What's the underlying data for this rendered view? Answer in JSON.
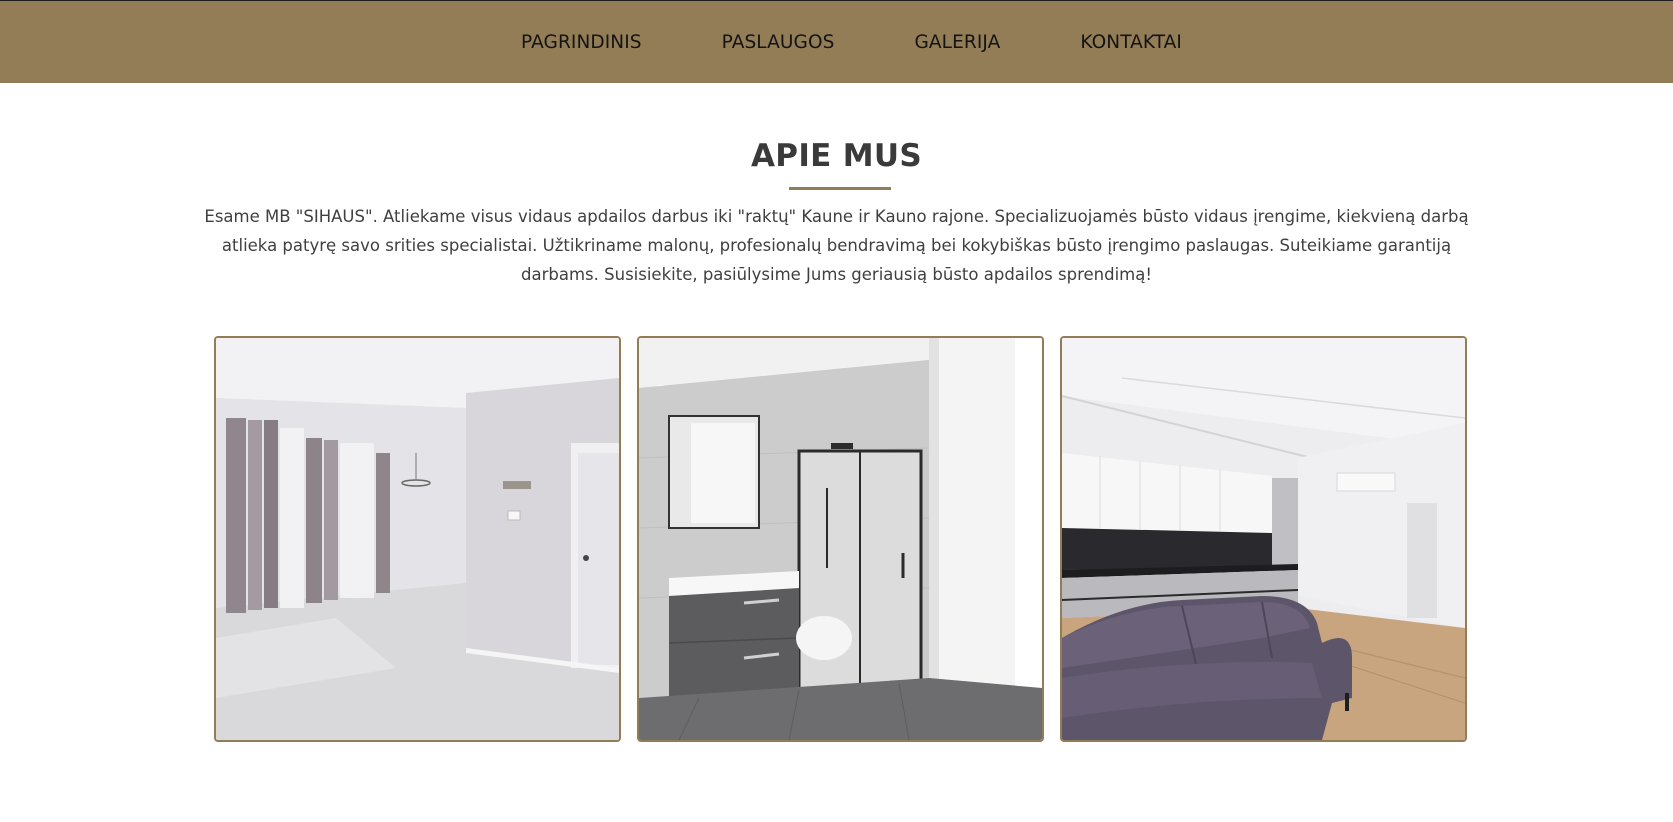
{
  "nav": {
    "items": [
      {
        "label": "PAGRINDINIS"
      },
      {
        "label": "PASLAUGOS"
      },
      {
        "label": "GALERIJA"
      },
      {
        "label": "KONTAKTAI"
      }
    ]
  },
  "about": {
    "title": "APIE MUS",
    "text": "Esame MB \"SIHAUS\". Atliekame visus vidaus apdailos darbus iki \"raktų\" Kaune ir Kauno rajone. Specializuojamės būsto vidaus įrengime, kiekvieną darbą atlieka patyrę savo srities specialistai. Užtikriname malonų, profesionalų bendravimą bei kokybiškas būsto įrengimo paslaugas. Suteikiame garantiją darbams. Susisiekite, pasiūlysime Jums geriausią būsto apdailos sprendimą!"
  },
  "gallery": {
    "images": [
      {
        "subject": "empty-living-room-with-curtains"
      },
      {
        "subject": "bathroom-with-shower-and-vanity"
      },
      {
        "subject": "kitchen-with-purple-sofa"
      }
    ]
  },
  "colors": {
    "accent": "#937d56",
    "nav_text": "#141414",
    "body_text": "#3f3f3f",
    "title_text": "#3a3a3a"
  }
}
